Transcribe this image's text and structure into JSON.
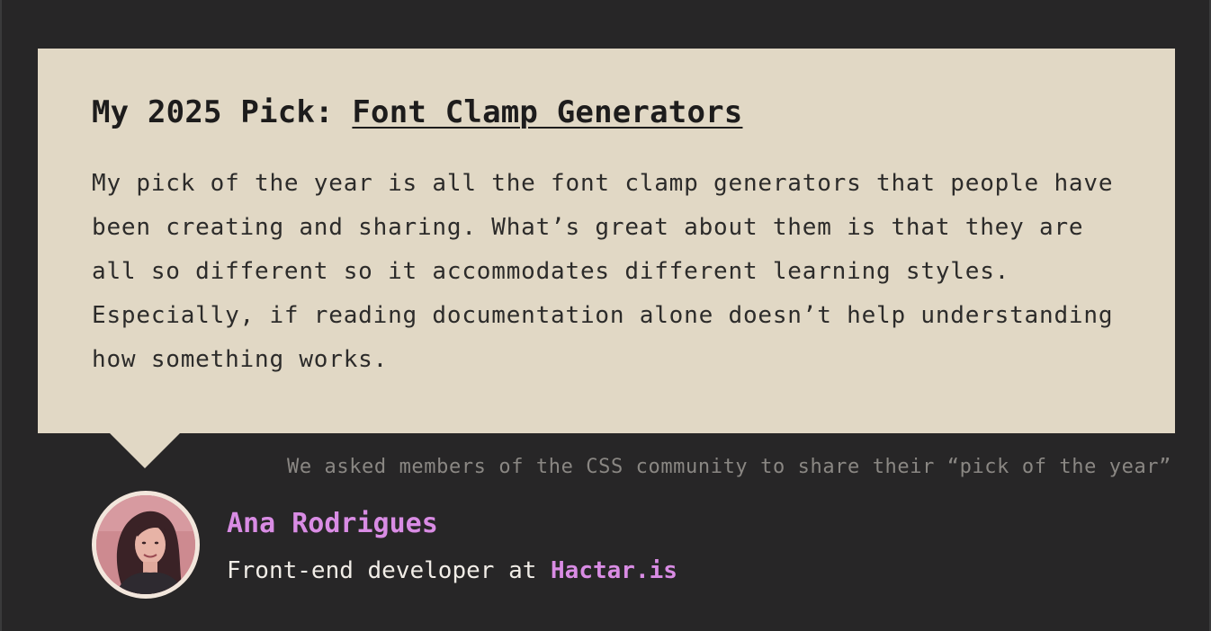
{
  "card": {
    "title_prefix": "My 2025 Pick: ",
    "title_link": "Font Clamp Generators",
    "body": "My pick of the year is all the font clamp generators that people have been creating and sharing. What’s great about them is that they are all so different so it accommodates different learning styles. Especially, if reading documentation alone doesn’t help understanding how something works."
  },
  "caption": "We asked members of the CSS community to share their “pick of the year”",
  "author": {
    "name": "Ana Rodrigues",
    "role_prefix": "Front-end developer at ",
    "company": "Hactar.is"
  },
  "colors": {
    "background": "#272627",
    "card": "#e1d8c5",
    "accent": "#d98ce4",
    "caption": "#8a8783"
  }
}
